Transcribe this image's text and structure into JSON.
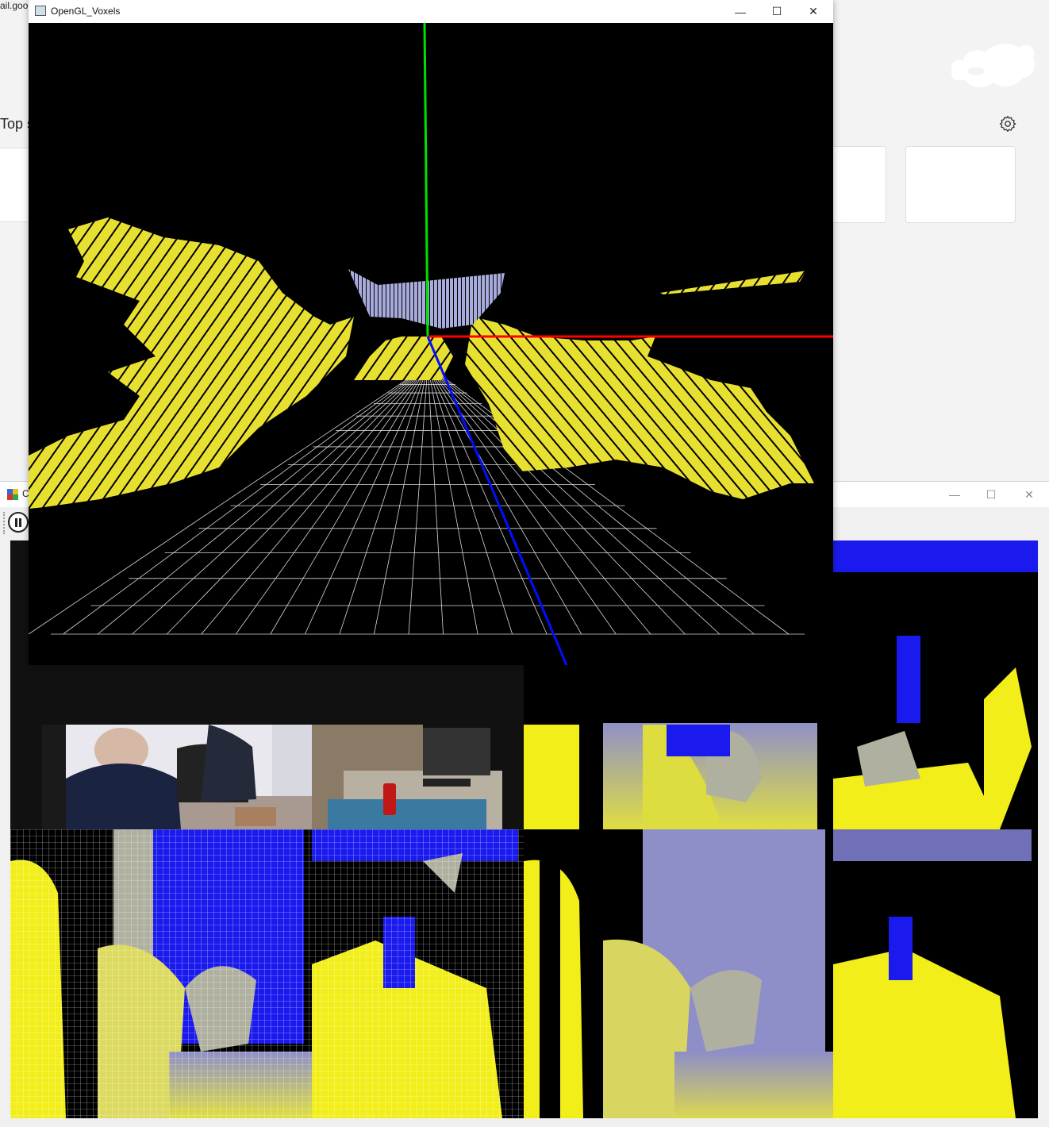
{
  "background_page": {
    "url_fragment": "ail.goo",
    "section_label": "Top si",
    "settings_icon": "gear-icon",
    "brand_logo": "cloud-blob-logo"
  },
  "depth_window": {
    "title": "C",
    "minimize_symbol": "—",
    "maximize_symbol": "☐",
    "close_symbol": "✕",
    "pause_icon": "pause-icon",
    "panes": [
      "color-camera-feed",
      "depth-map-raw",
      "depth-map-grid-overlay",
      "depth-map-filtered"
    ]
  },
  "gl_window": {
    "title": "OpenGL_Voxels",
    "minimize_symbol": "—",
    "maximize_symbol": "☐",
    "close_symbol": "✕",
    "scene": {
      "background": "#000000",
      "voxel_color": "#e8e030",
      "far_voxel_color": "#9aa0d8",
      "grid_color": "#ffffff",
      "axes": [
        {
          "name": "y-axis",
          "color": "#00e000"
        },
        {
          "name": "x-axis",
          "color": "#ff0000"
        },
        {
          "name": "z-axis",
          "color": "#0010ff"
        }
      ]
    }
  },
  "colors": {
    "depth_yellow": "#f2ee1a",
    "depth_blue": "#1a1aee",
    "depth_lavender": "#8e8ec8",
    "depth_gray": "#b0b0a0"
  }
}
